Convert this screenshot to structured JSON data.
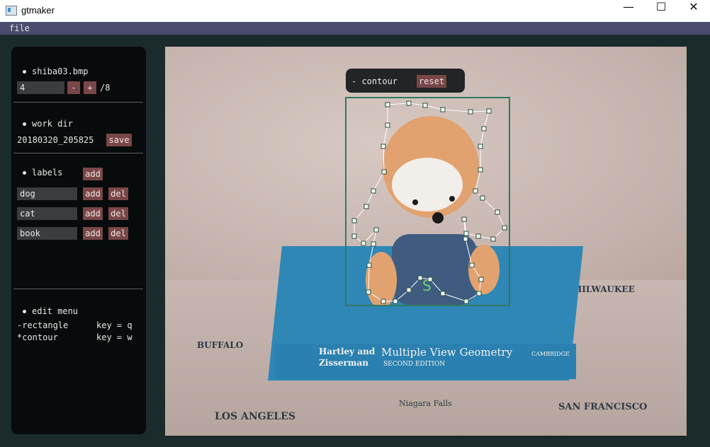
{
  "window": {
    "title": "gtmaker",
    "minimize_glyph": "—",
    "maximize_glyph": "☐",
    "close_glyph": "✕"
  },
  "menu": {
    "file": "file"
  },
  "image_section": {
    "filename": "shiba03.bmp",
    "index": "4",
    "prev_label": "-",
    "next_label": "+",
    "total": "/8"
  },
  "workdir_section": {
    "title": "work dir",
    "dir_value": "20180320_205825",
    "save_label": "save"
  },
  "labels_section": {
    "title": "labels",
    "add_label": "add",
    "items": [
      {
        "name": "dog",
        "add": "add",
        "del": "del"
      },
      {
        "name": "cat",
        "add": "add",
        "del": "del"
      },
      {
        "name": "book",
        "add": "add",
        "del": "del"
      }
    ]
  },
  "edit_menu": {
    "title": "edit menu",
    "rows": [
      {
        "mode": "-rectangle",
        "key": "key = q"
      },
      {
        "mode": "*contour",
        "key": "key = w"
      }
    ]
  },
  "contour_popup": {
    "title": "- contour",
    "reset_label": "reset"
  },
  "scene_text": {
    "authors_line1": "Hartley and",
    "authors_line2": "Zisserman",
    "book_title": "Multiple View Geometry",
    "edition": "SECOND EDITION",
    "publisher": "CAMBRIDGE",
    "overalls_letter": "S",
    "map_labels": [
      "MILWAUKEE",
      "BUFFALO",
      "LOS ANGELES",
      "Niagara Falls",
      "SAN FRANCISCO"
    ]
  },
  "colors": {
    "accent_button": "#784647",
    "panel_bg": "#080b0b",
    "menubar_bg": "#4a4b6e",
    "annotation_box": "#2f7a60"
  }
}
